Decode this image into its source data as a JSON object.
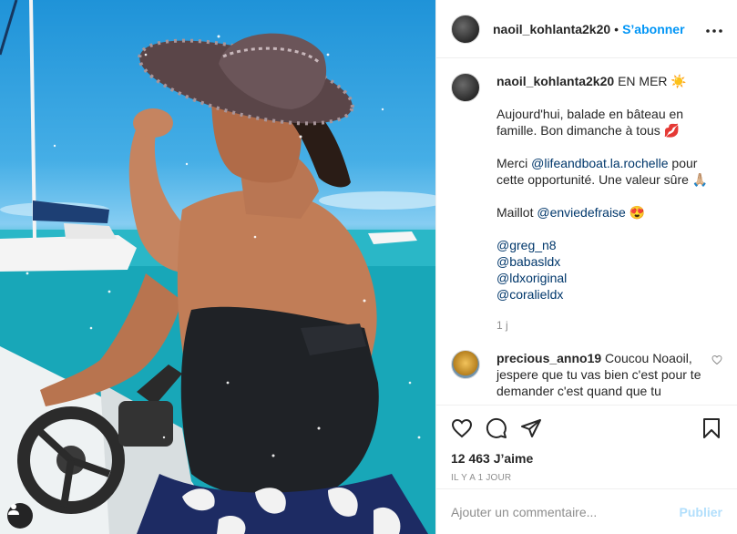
{
  "post": {
    "image_alt": "Woman in a striped sun hat steering a boat on turquoise sea",
    "user_tag_icon": "person-icon"
  },
  "header": {
    "username": "naoil_kohlanta2k20",
    "dot": "•",
    "follow_label": "S’abonner",
    "more_label": "•••"
  },
  "caption": {
    "username": "naoil_kohlanta2k20",
    "location_text": "EN MER ☀️",
    "line1": "Aujourd'hui, balade en bâteau en famille. Bon dimanche à tous 💋",
    "line2_prefix": "Merci ",
    "line2_mention": "@lifeandboat.la.rochelle",
    "line2_suffix": " pour cette opportunité. Une valeur sûre 🙏🏼",
    "line3_prefix": "Maillot ",
    "line3_mention": "@enviedefraise",
    "line3_suffix": " 😍",
    "mentions": [
      "@greg_n8",
      "@babasldx",
      "@ldxoriginal",
      "@coralieldx"
    ],
    "time": "1 j"
  },
  "comment": {
    "username": "precious_anno19",
    "text": " Coucou Noaoil, jespere que tu vas bien c'est pour te demander c'est quand que tu"
  },
  "actions": {
    "likes": "12 463 J’aime",
    "date": "IL Y A 1 JOUR"
  },
  "add_comment": {
    "placeholder": "Ajouter un commentaire...",
    "publish_label": "Publier"
  },
  "colors": {
    "accent": "#0095f6",
    "publish_disabled": "#b2dffc",
    "link": "#00376b",
    "muted": "#8e8e8e"
  }
}
